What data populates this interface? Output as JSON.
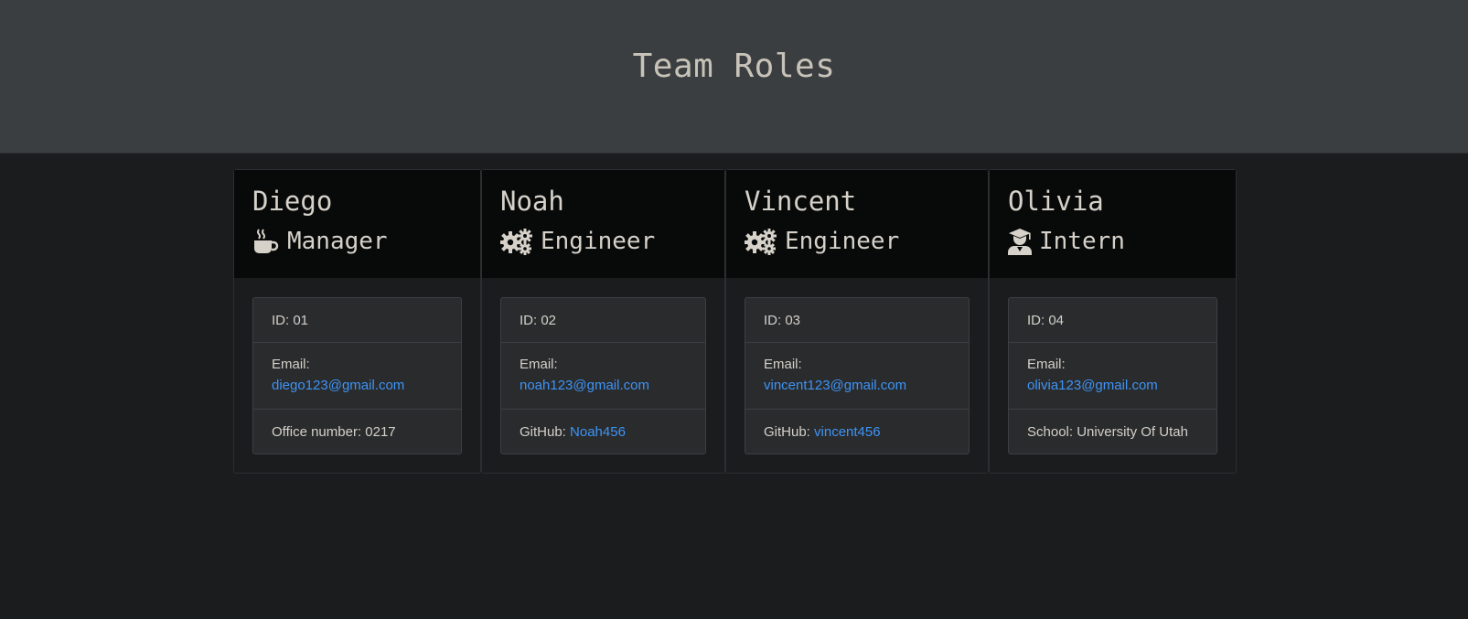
{
  "header": {
    "title": "Team Roles"
  },
  "cards": [
    {
      "name": "Diego",
      "role": "Manager",
      "role_icon": "coffee-mug-icon",
      "id_label": "ID:",
      "id": "01",
      "email_label": "Email:",
      "email": "diego123@gmail.com",
      "extra_label": "Office number:",
      "extra_value": "0217"
    },
    {
      "name": "Noah",
      "role": "Engineer",
      "role_icon": "cogs-icon",
      "id_label": "ID:",
      "id": "02",
      "email_label": "Email:",
      "email": "noah123@gmail.com",
      "extra_label": "GitHub:",
      "extra_value": "Noah456"
    },
    {
      "name": "Vincent",
      "role": "Engineer",
      "role_icon": "cogs-icon",
      "id_label": "ID:",
      "id": "03",
      "email_label": "Email:",
      "email": "vincent123@gmail.com",
      "extra_label": "GitHub:",
      "extra_value": "vincent456"
    },
    {
      "name": "Olivia",
      "role": "Intern",
      "role_icon": "graduate-icon",
      "id_label": "ID:",
      "id": "04",
      "email_label": "Email:",
      "email": "olivia123@gmail.com",
      "extra_label": "School:",
      "extra_value": "University Of Utah"
    }
  ],
  "colors": {
    "header_bg": "#3b3e41",
    "page_bg": "#1b1c1e",
    "card_header_bg": "#080909",
    "link": "#3d94f6",
    "text": "#d4d0c9"
  }
}
